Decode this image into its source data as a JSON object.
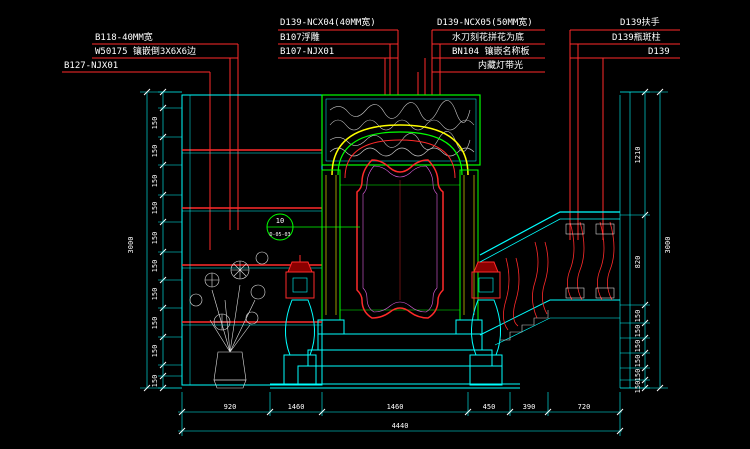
{
  "callouts_top": {
    "c1": "D139-NCX04(40MM宽)",
    "c2": "B107浮雕",
    "c3": "B107-NJX01",
    "c4": "D139-NCX05(50MM宽)",
    "c5": "水刀刻花拼花为底",
    "c6": "BN104 镶嵌名称板",
    "c7": "内藏灯带光",
    "c8": "D139扶手",
    "c9": "D139瓶斑柱",
    "c10": "D139"
  },
  "callouts_left": {
    "l1": "B118-40MM宽",
    "l2": "W50175 镶嵌倒3X6X6边",
    "l3": "B127-NJX01"
  },
  "tag": {
    "top": "10",
    "bottom": "D-05-03"
  },
  "dims_bottom": {
    "d1": "920",
    "d2": "1460",
    "d3": "1460",
    "d4": "450",
    "d5": "390",
    "d6": "720",
    "total": "4440"
  },
  "dims_left": {
    "rows": [
      "150",
      "150",
      "150",
      "150",
      "150",
      "150",
      "150",
      "150",
      "150",
      "150",
      "150",
      "150"
    ],
    "total": "3000"
  },
  "dims_right": {
    "a": "1210",
    "b": "820",
    "c": "150",
    "d": "150",
    "e": "150",
    "f": "150",
    "g": "150",
    "h": "150",
    "total": "3000"
  },
  "colors": {
    "background": "#000000",
    "leader": "#ff2a2a",
    "dimension": "#00ffff",
    "frame_green": "#00ff00",
    "arch_yellow": "#ffff00",
    "text": "#ffffff"
  }
}
